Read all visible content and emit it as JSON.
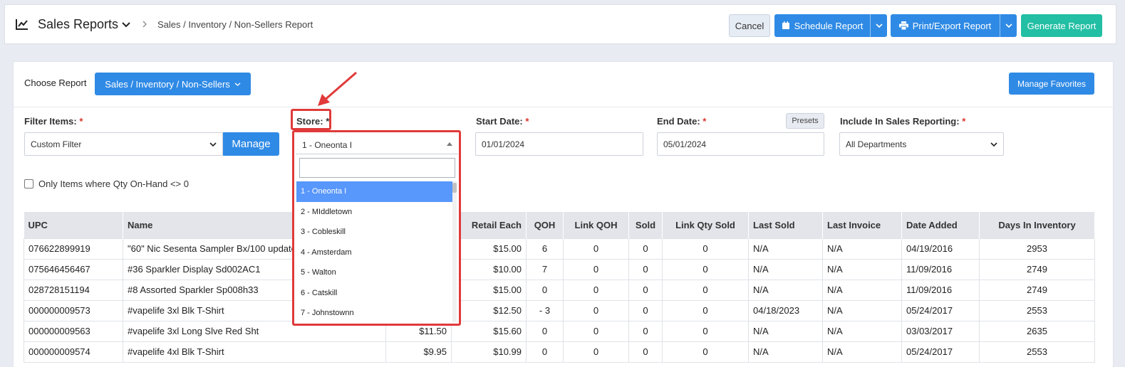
{
  "header": {
    "title": "Sales Reports",
    "breadcrumb": "Sales / Inventory / Non-Sellers Report",
    "buttons": {
      "cancel": "Cancel",
      "schedule": "Schedule Report",
      "print": "Print/Export Report",
      "generate": "Generate Report"
    }
  },
  "report": {
    "choose_label": "Choose Report",
    "selected": "Sales / Inventory / Non-Sellers",
    "manage_favorites": "Manage Favorites"
  },
  "filters": {
    "filter_items": {
      "label": "Filter Items:",
      "required": "*",
      "value": "Custom Filter",
      "manage": "Manage"
    },
    "store": {
      "label": "Store:",
      "required": "*",
      "value": "1 - Oneonta I",
      "search_placeholder": ""
    },
    "start_date": {
      "label": "Start Date:",
      "required": "*",
      "value": "01/01/2024"
    },
    "end_date": {
      "label": "End Date:",
      "required": "*",
      "value": "05/01/2024",
      "presets": "Presets"
    },
    "include": {
      "label": "Include In Sales Reporting:",
      "required": "*",
      "value": "All Departments"
    },
    "qty_checkbox": "Only Items where Qty On-Hand <> 0"
  },
  "store_options": [
    "1 - Oneonta I",
    "2 - MIddletown",
    "3 - Cobleskill",
    "4 - Amsterdam",
    "5 - Walton",
    "6 - Catskill",
    "7 - Johnstownn"
  ],
  "table": {
    "columns": [
      "UPC",
      "Name",
      "",
      "Retail Each",
      "QOH",
      "Link QOH",
      "Sold",
      "Link Qty Sold",
      "Last Sold",
      "Last Invoice",
      "Date Added",
      "Days In Inventory"
    ],
    "rows": [
      [
        "076622899919",
        "\"60\" Nic Sesenta Sampler Bx/100 update",
        "",
        "$15.00",
        "6",
        "0",
        "0",
        "0",
        "N/A",
        "N/A",
        "04/19/2016",
        "2953"
      ],
      [
        "075646456467",
        "#36 Sparkler Display Sd002AC1",
        "",
        "$10.00",
        "7",
        "0",
        "0",
        "0",
        "N/A",
        "N/A",
        "11/09/2016",
        "2749"
      ],
      [
        "028728151194",
        "#8 Assorted Sparkler Sp008h33",
        "",
        "$15.00",
        "0",
        "0",
        "0",
        "0",
        "N/A",
        "N/A",
        "11/09/2016",
        "2749"
      ],
      [
        "000000009573",
        "#vapelife 3xl Blk T-Shirt",
        "",
        "$12.50",
        "- 3",
        "0",
        "0",
        "0",
        "04/18/2023",
        "N/A",
        "05/24/2017",
        "2553"
      ],
      [
        "000000009563",
        "#vapelife 3xl Long Slve Red Sht",
        "$11.50",
        "$15.60",
        "0",
        "0",
        "0",
        "0",
        "N/A",
        "N/A",
        "03/03/2017",
        "2635"
      ],
      [
        "000000009574",
        "#vapelife 4xl Blk T-Shirt",
        "$9.95",
        "$10.99",
        "0",
        "0",
        "0",
        "0",
        "N/A",
        "N/A",
        "05/24/2017",
        "2553"
      ]
    ]
  },
  "colors": {
    "primary": "#2f8ae5",
    "success": "#22bfa4",
    "highlight": "#e03a3a",
    "option_active": "#5897fb"
  }
}
